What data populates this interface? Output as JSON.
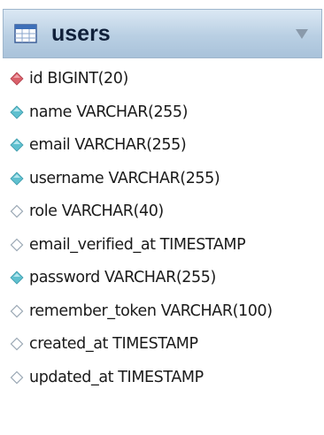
{
  "entity": {
    "title": "users",
    "columns": [
      {
        "label": "id BIGINT(20)",
        "key": "primary"
      },
      {
        "label": "name VARCHAR(255)",
        "key": "not-null"
      },
      {
        "label": "email VARCHAR(255)",
        "key": "not-null"
      },
      {
        "label": "username VARCHAR(255)",
        "key": "not-null"
      },
      {
        "label": "role VARCHAR(40)",
        "key": "nullable"
      },
      {
        "label": "email_verified_at TIMESTAMP",
        "key": "nullable"
      },
      {
        "label": "password VARCHAR(255)",
        "key": "not-null"
      },
      {
        "label": "remember_token VARCHAR(100)",
        "key": "nullable"
      },
      {
        "label": "created_at TIMESTAMP",
        "key": "nullable"
      },
      {
        "label": "updated_at TIMESTAMP",
        "key": "nullable"
      }
    ]
  },
  "colors": {
    "primary_key": "#d9606a",
    "not_null": "#5fc0cf",
    "nullable_outline": "#9aa8b4",
    "header_gradient_top": "#dbe8f4",
    "header_gradient_bottom": "#a9c2da"
  },
  "icons": {
    "table": "table-icon",
    "collapse": "collapse-arrow-icon",
    "primary": "primary-key-diamond-icon",
    "not-null": "not-null-diamond-icon",
    "nullable": "nullable-diamond-icon"
  }
}
